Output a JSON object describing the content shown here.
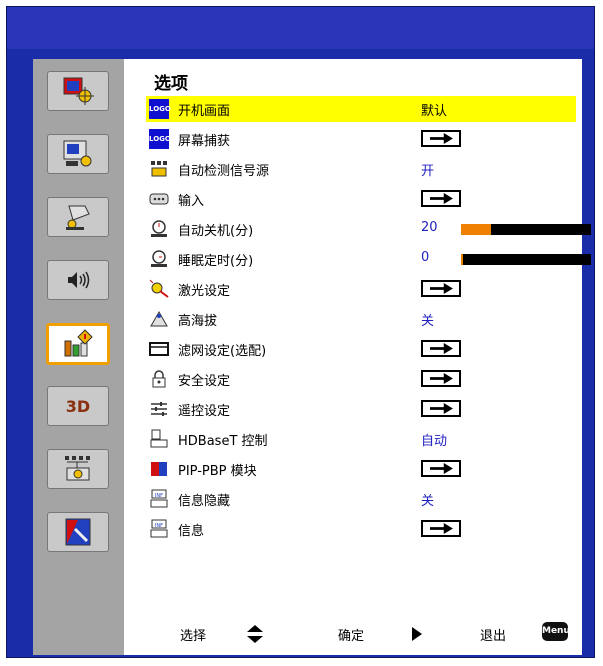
{
  "menu": {
    "title": "选项",
    "items": [
      {
        "label": "开机画面",
        "icon": "logo-icon",
        "value": "默认",
        "control": "text"
      },
      {
        "label": "屏幕捕获",
        "icon": "logo-capture-icon",
        "control": "arrow"
      },
      {
        "label": "自动检测信号源",
        "icon": "auto-source-icon",
        "value": "开",
        "control": "text"
      },
      {
        "label": "输入",
        "icon": "input-port-icon",
        "control": "arrow"
      },
      {
        "label": "自动关机(分)",
        "icon": "auto-power-off-icon",
        "value": "20",
        "control": "slider",
        "level": 0.23
      },
      {
        "label": "睡眠定时(分)",
        "icon": "sleep-timer-icon",
        "value": "0",
        "control": "slider",
        "level": 0.01
      },
      {
        "label": "激光设定",
        "icon": "laser-icon",
        "control": "arrow"
      },
      {
        "label": "高海拔",
        "icon": "high-altitude-icon",
        "value": "关",
        "control": "text"
      },
      {
        "label": "滤网设定(选配)",
        "icon": "filter-icon",
        "control": "arrow"
      },
      {
        "label": "安全设定",
        "icon": "lock-icon",
        "control": "arrow"
      },
      {
        "label": "遥控设定",
        "icon": "remote-sliders-icon",
        "control": "arrow"
      },
      {
        "label": "HDBaseT  控制",
        "icon": "hdbaset-icon",
        "value": "自动",
        "control": "text"
      },
      {
        "label": "PIP-PBP 模块",
        "icon": "pip-pbp-icon",
        "control": "arrow"
      },
      {
        "label": "信息隐藏",
        "icon": "info-hide-icon",
        "value": "关",
        "control": "text"
      },
      {
        "label": "信息",
        "icon": "info-icon",
        "control": "arrow"
      }
    ]
  },
  "footer": {
    "select_label": "选择",
    "enter_label": "确定",
    "exit_label": "退出",
    "menu_key": "Menu"
  },
  "sidebar": {
    "tabs": [
      "image-settings-icon",
      "display-settings-icon",
      "setup-icon",
      "audio-icon",
      "options-icon",
      "3d-icon",
      "network-icon",
      "tools-icon"
    ],
    "tab_3d_label": "3D",
    "active_index": 4
  },
  "colors": {
    "frame": "#1a2ca8",
    "highlight": "#ffff00",
    "value_text": "#2020c0",
    "slider_fill": "#f08000"
  }
}
